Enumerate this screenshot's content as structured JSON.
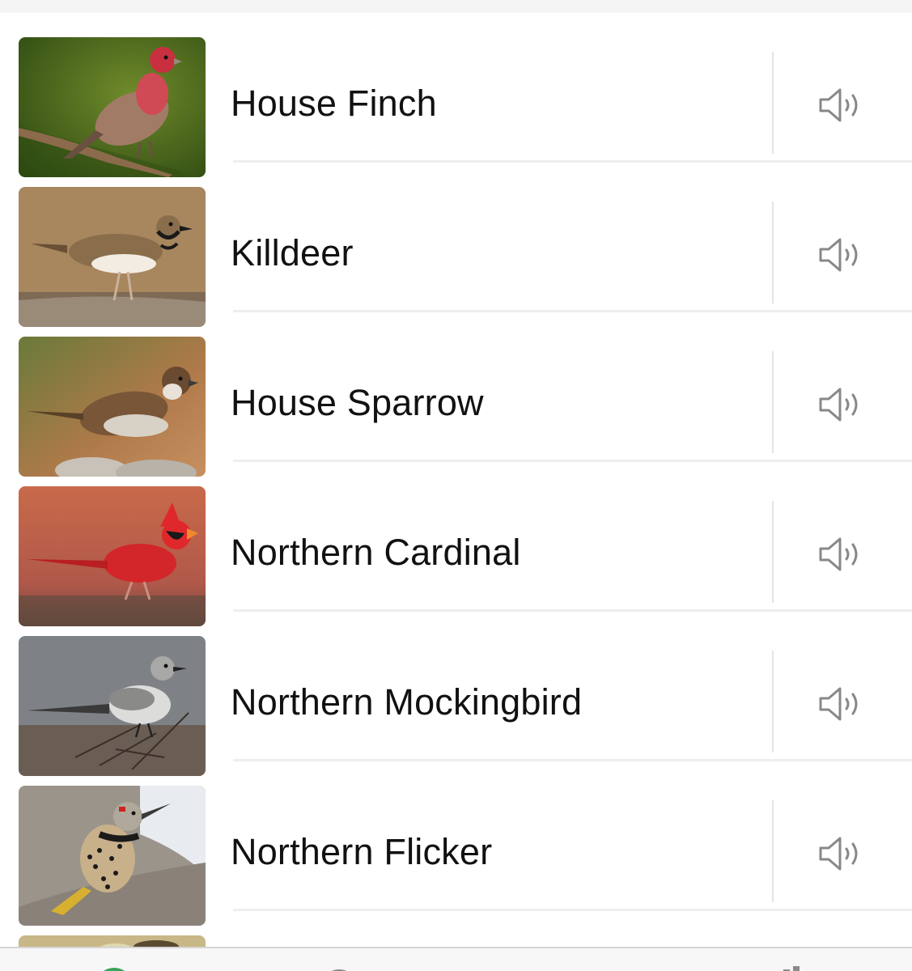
{
  "birds": [
    {
      "name": "House Finch",
      "thumbnail_icon": "house-finch-photo",
      "sound_icon": "speaker-icon"
    },
    {
      "name": "Killdeer",
      "thumbnail_icon": "killdeer-photo",
      "sound_icon": "speaker-icon"
    },
    {
      "name": "House Sparrow",
      "thumbnail_icon": "house-sparrow-photo",
      "sound_icon": "speaker-icon"
    },
    {
      "name": "Northern Cardinal",
      "thumbnail_icon": "northern-cardinal-photo",
      "sound_icon": "speaker-icon"
    },
    {
      "name": "Northern Mockingbird",
      "thumbnail_icon": "northern-mockingbird-photo",
      "sound_icon": "speaker-icon"
    },
    {
      "name": "Northern Flicker",
      "thumbnail_icon": "northern-flicker-photo",
      "sound_icon": "speaker-icon"
    }
  ],
  "tabbar": {
    "icons": [
      "tab-icon-green-circle",
      "tab-icon-gray-circle",
      "tab-icon-gray"
    ]
  },
  "colors": {
    "text": "#111111",
    "icon_gray": "#888888",
    "divider": "#eeeeee",
    "accent_green": "#3aa55a"
  }
}
